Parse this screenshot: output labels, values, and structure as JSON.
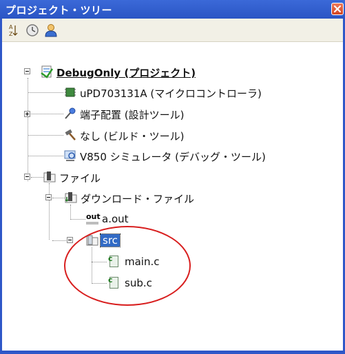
{
  "window": {
    "title": "プロジェクト・ツリー",
    "accent": "#2f57c8"
  },
  "toolbar": {
    "items": [
      {
        "icon": "sort-az-icon"
      },
      {
        "icon": "clock-icon"
      },
      {
        "icon": "user-icon"
      }
    ]
  },
  "tree": {
    "project": {
      "label": "DebugOnly (プロジェクト)"
    },
    "microcontroller": {
      "label": "uPD703131A (マイクロコントローラ)"
    },
    "pin_config": {
      "label": "端子配置 (設計ツール)"
    },
    "build_tool": {
      "label": "なし (ビルド・ツール)"
    },
    "debug_tool": {
      "label": "V850 シミュレータ (デバッグ・ツール)"
    },
    "files": {
      "label": "ファイル"
    },
    "download": {
      "label": "ダウンロード・ファイル"
    },
    "aout": {
      "label": "a.out",
      "icon_text": "out"
    },
    "src": {
      "label": "src"
    },
    "main_c": {
      "label": "main.c",
      "icon_text": "c"
    },
    "sub_c": {
      "label": "sub.c",
      "icon_text": "c"
    }
  },
  "annotation": {
    "color": "#d81e1e"
  }
}
